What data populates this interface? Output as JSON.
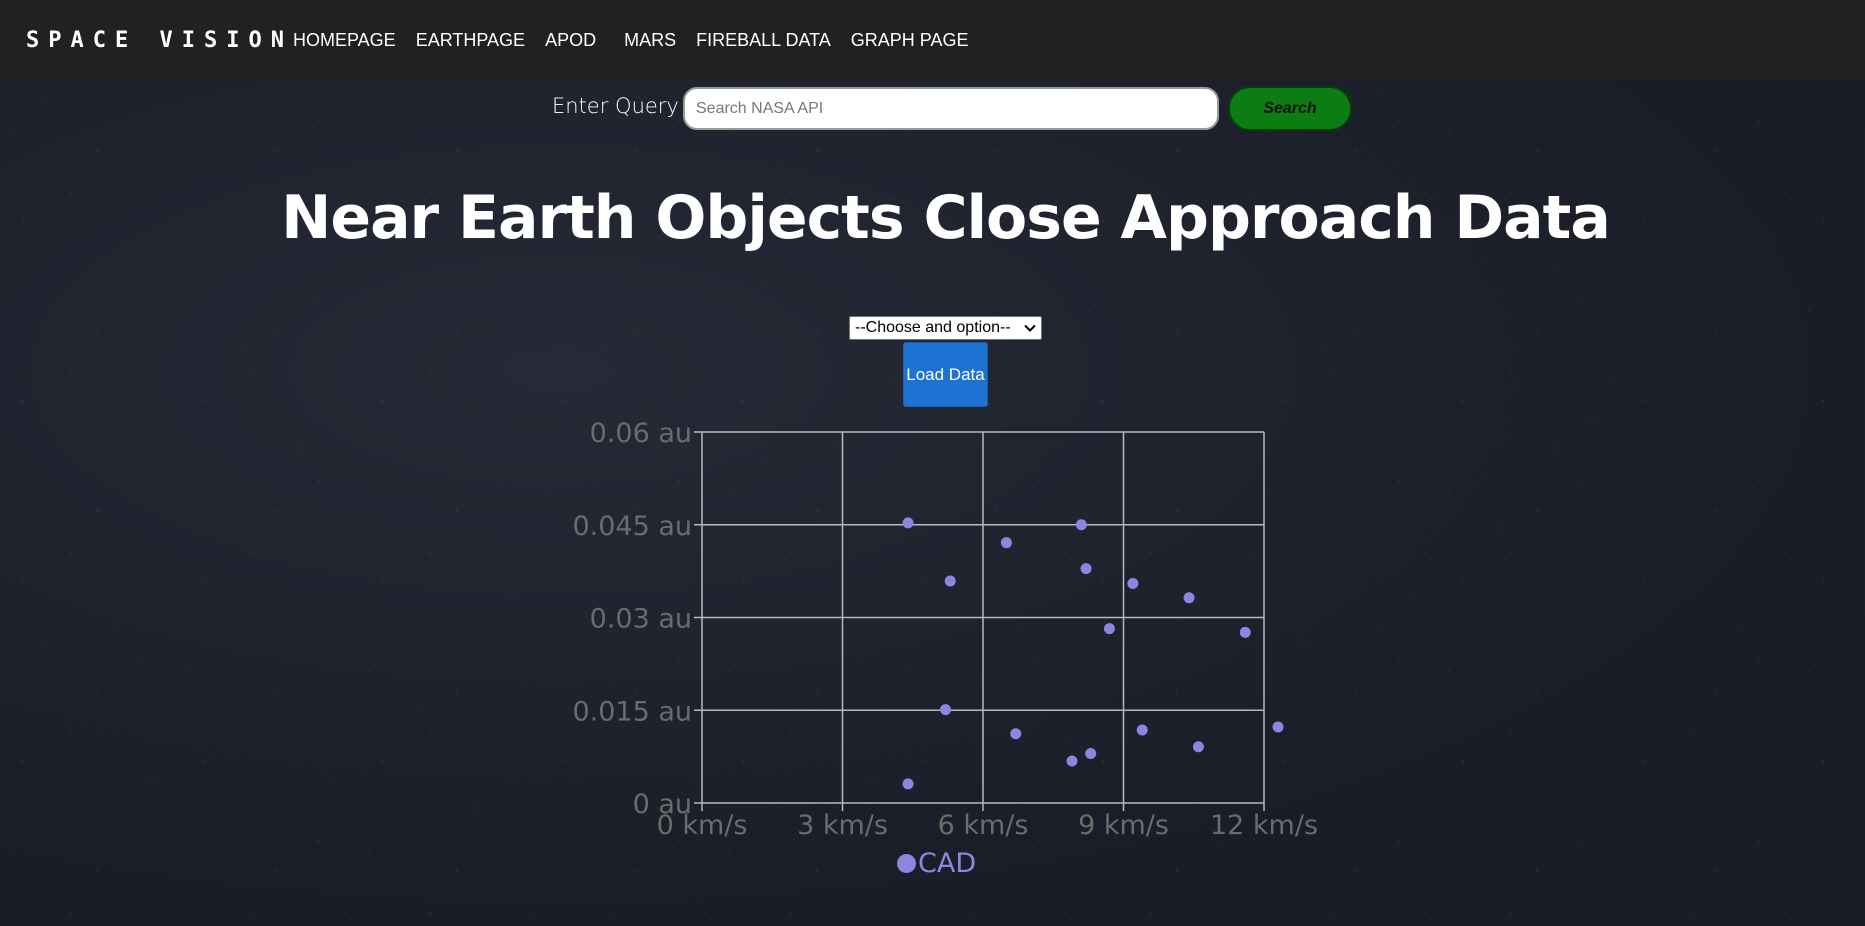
{
  "navbar": {
    "brand": "SPACE VISION",
    "links": [
      "HOMEPAGE",
      "EARTHPAGE",
      "APOD",
      "MARS",
      "FIREBALL DATA",
      "GRAPH PAGE"
    ]
  },
  "search": {
    "label": "Enter Query",
    "placeholder": "Search NASA API",
    "value": "",
    "button_label": "Search"
  },
  "page_title": "Near Earth Objects Close Approach Data",
  "controls": {
    "select_value": "--Choose and option--",
    "load_button_label": "Load Data"
  },
  "colors": {
    "point": "#8b86e0",
    "grid": "#b9b9b9",
    "tick_text": "#6b6b6b",
    "search_button": "#0c7d12",
    "load_button": "#1e73d2"
  },
  "chart_data": {
    "type": "scatter",
    "xlim": [
      0,
      12
    ],
    "ylim": [
      0,
      0.06
    ],
    "x_ticks": [
      0,
      3,
      6,
      9,
      12
    ],
    "y_ticks": [
      0,
      0.015,
      0.03,
      0.045,
      0.06
    ],
    "x_tick_labels": [
      "0 km/s",
      "3 km/s",
      "6 km/s",
      "9 km/s",
      "12 km/s"
    ],
    "y_tick_labels": [
      "0 au",
      "0.015 au",
      "0.03 au",
      "0.045 au",
      "0.06 au"
    ],
    "grid": true,
    "legend_position": "bottom",
    "series": [
      {
        "name": "CAD",
        "points": [
          [
            4.4,
            0.0453
          ],
          [
            5.3,
            0.0359
          ],
          [
            6.5,
            0.0421
          ],
          [
            8.1,
            0.045
          ],
          [
            8.2,
            0.0379
          ],
          [
            9.2,
            0.0355
          ],
          [
            10.4,
            0.0332
          ],
          [
            8.7,
            0.0282
          ],
          [
            11.6,
            0.0276
          ],
          [
            5.2,
            0.0151
          ],
          [
            6.7,
            0.0112
          ],
          [
            9.4,
            0.0118
          ],
          [
            12.3,
            0.0123
          ],
          [
            10.6,
            0.0091
          ],
          [
            8.3,
            0.008
          ],
          [
            7.9,
            0.0068
          ],
          [
            4.4,
            0.0031
          ]
        ]
      }
    ]
  }
}
